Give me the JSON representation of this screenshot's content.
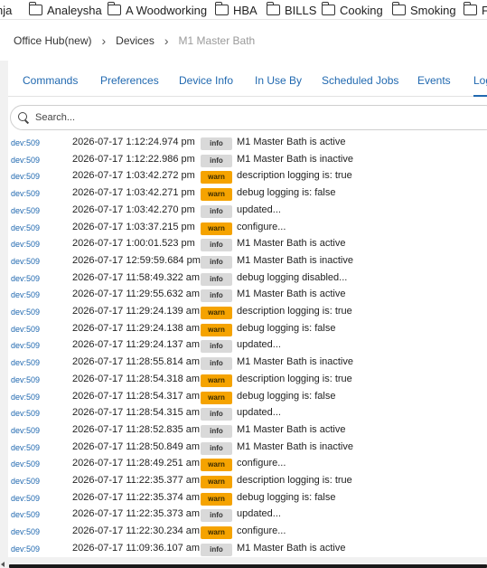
{
  "bookmarks": [
    {
      "label": "nja",
      "folder": false
    },
    {
      "label": "Analeysha",
      "folder": true
    },
    {
      "label": "A Woodworking",
      "folder": true
    },
    {
      "label": "HBA",
      "folder": true
    },
    {
      "label": "BILLS",
      "folder": true
    },
    {
      "label": "Cooking",
      "folder": true
    },
    {
      "label": "Smoking",
      "folder": true
    },
    {
      "label": "F",
      "folder": true
    }
  ],
  "breadcrumb": {
    "items": [
      "Office Hub(new)",
      "Devices",
      "M1 Master Bath"
    ]
  },
  "tabs": [
    "Commands",
    "Preferences",
    "Device Info",
    "In Use By",
    "Scheduled Jobs",
    "Events",
    "Logs"
  ],
  "search": {
    "placeholder": "Search..."
  },
  "log_rows": [
    {
      "dev": "dev:509",
      "time": "2026-07-17 1:12:24.974 pm",
      "level": "info",
      "message": "M1 Master Bath is active"
    },
    {
      "dev": "dev:509",
      "time": "2026-07-17 1:12:22.986 pm",
      "level": "info",
      "message": "M1 Master Bath is inactive"
    },
    {
      "dev": "dev:509",
      "time": "2026-07-17 1:03:42.272 pm",
      "level": "warn",
      "message": "description logging is: true"
    },
    {
      "dev": "dev:509",
      "time": "2026-07-17 1:03:42.271 pm",
      "level": "warn",
      "message": "debug logging is: false"
    },
    {
      "dev": "dev:509",
      "time": "2026-07-17 1:03:42.270 pm",
      "level": "info",
      "message": "updated..."
    },
    {
      "dev": "dev:509",
      "time": "2026-07-17 1:03:37.215 pm",
      "level": "warn",
      "message": "configure..."
    },
    {
      "dev": "dev:509",
      "time": "2026-07-17 1:00:01.523 pm",
      "level": "info",
      "message": "M1 Master Bath is active"
    },
    {
      "dev": "dev:509",
      "time": "2026-07-17 12:59:59.684 pm",
      "level": "info",
      "message": "M1 Master Bath is inactive"
    },
    {
      "dev": "dev:509",
      "time": "2026-07-17 11:58:49.322 am",
      "level": "info",
      "message": "debug logging disabled..."
    },
    {
      "dev": "dev:509",
      "time": "2026-07-17 11:29:55.632 am",
      "level": "info",
      "message": "M1 Master Bath is active"
    },
    {
      "dev": "dev:509",
      "time": "2026-07-17 11:29:24.139 am",
      "level": "warn",
      "message": "description logging is: true"
    },
    {
      "dev": "dev:509",
      "time": "2026-07-17 11:29:24.138 am",
      "level": "warn",
      "message": "debug logging is: false"
    },
    {
      "dev": "dev:509",
      "time": "2026-07-17 11:29:24.137 am",
      "level": "info",
      "message": "updated..."
    },
    {
      "dev": "dev:509",
      "time": "2026-07-17 11:28:55.814 am",
      "level": "info",
      "message": "M1 Master Bath is inactive"
    },
    {
      "dev": "dev:509",
      "time": "2026-07-17 11:28:54.318 am",
      "level": "warn",
      "message": "description logging is: true"
    },
    {
      "dev": "dev:509",
      "time": "2026-07-17 11:28:54.317 am",
      "level": "warn",
      "message": "debug logging is: false"
    },
    {
      "dev": "dev:509",
      "time": "2026-07-17 11:28:54.315 am",
      "level": "info",
      "message": "updated..."
    },
    {
      "dev": "dev:509",
      "time": "2026-07-17 11:28:52.835 am",
      "level": "info",
      "message": "M1 Master Bath is active"
    },
    {
      "dev": "dev:509",
      "time": "2026-07-17 11:28:50.849 am",
      "level": "info",
      "message": "M1 Master Bath is inactive"
    },
    {
      "dev": "dev:509",
      "time": "2026-07-17 11:28:49.251 am",
      "level": "warn",
      "message": "configure..."
    },
    {
      "dev": "dev:509",
      "time": "2026-07-17 11:22:35.377 am",
      "level": "warn",
      "message": "description logging is: true"
    },
    {
      "dev": "dev:509",
      "time": "2026-07-17 11:22:35.374 am",
      "level": "warn",
      "message": "debug logging is: false"
    },
    {
      "dev": "dev:509",
      "time": "2026-07-17 11:22:35.373 am",
      "level": "info",
      "message": "updated..."
    },
    {
      "dev": "dev:509",
      "time": "2026-07-17 11:22:30.234 am",
      "level": "warn",
      "message": "configure..."
    },
    {
      "dev": "dev:509",
      "time": "2026-07-17 11:09:36.107 am",
      "level": "info",
      "message": "M1 Master Bath is active"
    }
  ],
  "colors": {
    "link": "#2169b0",
    "warn": "#f5a300",
    "info": "#d9d9d9"
  },
  "icons": {
    "bookmark": "folder-icon",
    "search": "search-icon",
    "separator": "chevron-right-icon"
  }
}
